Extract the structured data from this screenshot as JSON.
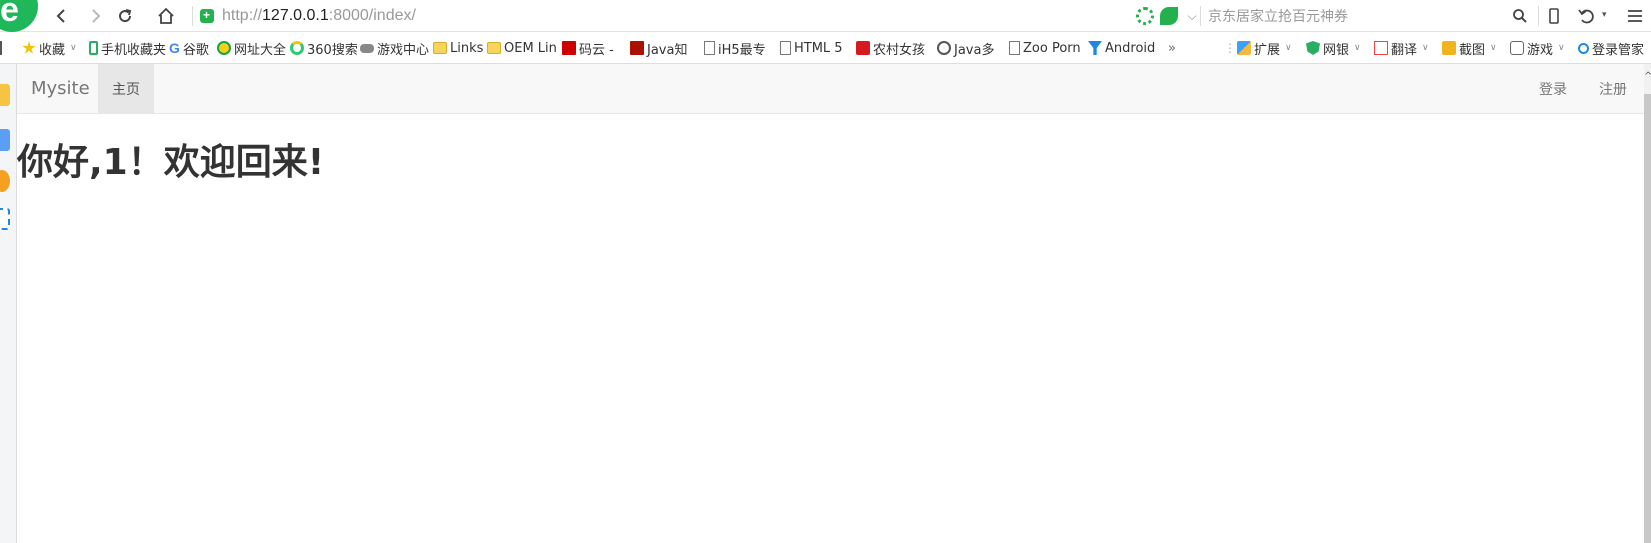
{
  "browser": {
    "address": {
      "protocol": "http://",
      "host": "127.0.0.1",
      "path": ":8000/index/"
    },
    "search": {
      "placeholder": "京东居家立抢百元神券"
    },
    "icons": {
      "back": "back-arrow-icon",
      "forward": "forward-arrow-icon",
      "reload": "reload-icon",
      "home": "home-icon",
      "secure": "secure-shield-icon",
      "menu": "hamburger-menu-icon"
    },
    "accent_color": "#20b65a"
  },
  "bookmarks": {
    "left": [
      {
        "label": "收藏",
        "icon": "star-icon",
        "dropdown": true
      },
      {
        "label": "手机收藏夹",
        "icon": "phone-icon"
      },
      {
        "label": "谷歌",
        "icon": "google-icon"
      },
      {
        "label": "网址大全",
        "icon": "web-directory-icon"
      },
      {
        "label": "360搜索",
        "icon": "360-search-icon"
      },
      {
        "label": "游戏中心",
        "icon": "gamepad-icon"
      },
      {
        "label": "Links",
        "icon": "folder-icon"
      },
      {
        "label": "OEM Lin",
        "icon": "folder-icon"
      },
      {
        "label": "码云 -",
        "icon": "gitee-icon"
      },
      {
        "label": "Java知",
        "icon": "java-icon"
      },
      {
        "label": "iH5最专",
        "icon": "page-icon"
      },
      {
        "label": "HTML 5",
        "icon": "page-icon"
      },
      {
        "label": "农村女孩",
        "icon": "c-logo-icon"
      },
      {
        "label": "Java多",
        "icon": "java-swirl-icon"
      },
      {
        "label": "Zoo Porn",
        "icon": "page-icon"
      },
      {
        "label": "Android",
        "icon": "filter-icon"
      }
    ],
    "overflow": "»",
    "right": [
      {
        "label": "扩展",
        "icon": "extensions-icon"
      },
      {
        "label": "网银",
        "icon": "bank-shield-icon"
      },
      {
        "label": "翻译",
        "icon": "translate-icon"
      },
      {
        "label": "截图",
        "icon": "screenshot-icon"
      },
      {
        "label": "游戏",
        "icon": "gamepad-icon"
      },
      {
        "label": "登录管家",
        "icon": "login-manager-icon"
      }
    ]
  },
  "site": {
    "brand": "Mysite",
    "nav": {
      "home": "主页",
      "login": "登录",
      "register": "注册"
    },
    "greeting": "你好,1！欢迎回来!"
  }
}
